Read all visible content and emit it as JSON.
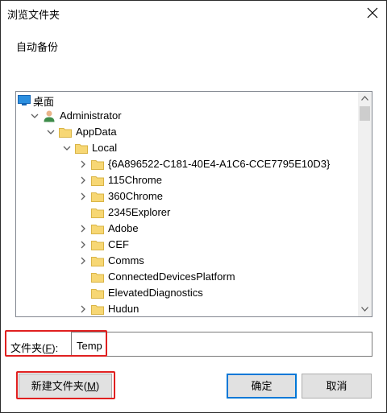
{
  "window": {
    "title": "浏览文件夹"
  },
  "description": "自动备份",
  "tree": {
    "items": [
      {
        "label": "桌面",
        "icon": "desktop-icon",
        "level": 0,
        "expander": "none"
      },
      {
        "label": "Administrator",
        "icon": "user-icon",
        "level": 1,
        "expander": "expanded"
      },
      {
        "label": "AppData",
        "icon": "folder-icon",
        "level": 2,
        "expander": "expanded"
      },
      {
        "label": "Local",
        "icon": "folder-icon",
        "level": 3,
        "expander": "expanded"
      },
      {
        "label": "{6A896522-C181-40E4-A1C6-CCE7795E10D3}",
        "icon": "folder-icon",
        "level": 4,
        "expander": "collapsed"
      },
      {
        "label": "115Chrome",
        "icon": "folder-icon",
        "level": 4,
        "expander": "collapsed"
      },
      {
        "label": "360Chrome",
        "icon": "folder-icon",
        "level": 4,
        "expander": "collapsed"
      },
      {
        "label": "2345Explorer",
        "icon": "folder-icon",
        "level": 4,
        "expander": "none"
      },
      {
        "label": "Adobe",
        "icon": "folder-icon",
        "level": 4,
        "expander": "collapsed"
      },
      {
        "label": "CEF",
        "icon": "folder-icon",
        "level": 4,
        "expander": "collapsed"
      },
      {
        "label": "Comms",
        "icon": "folder-icon",
        "level": 4,
        "expander": "collapsed"
      },
      {
        "label": "ConnectedDevicesPlatform",
        "icon": "folder-icon",
        "level": 4,
        "expander": "none"
      },
      {
        "label": "ElevatedDiagnostics",
        "icon": "folder-icon",
        "level": 4,
        "expander": "none"
      },
      {
        "label": "Hudun",
        "icon": "folder-icon",
        "level": 4,
        "expander": "collapsed"
      }
    ]
  },
  "folder_field": {
    "label": "文件夹(",
    "accesskey": "F",
    "label_end": "):",
    "value": "Temp"
  },
  "buttons": {
    "new_folder": {
      "label": "新建文件夹(",
      "accesskey": "M",
      "label_end": ")"
    },
    "ok": "确定",
    "cancel": "取消"
  },
  "colors": {
    "highlight": "#e02020",
    "focus": "#0078d7",
    "folder": "#f7d774"
  }
}
